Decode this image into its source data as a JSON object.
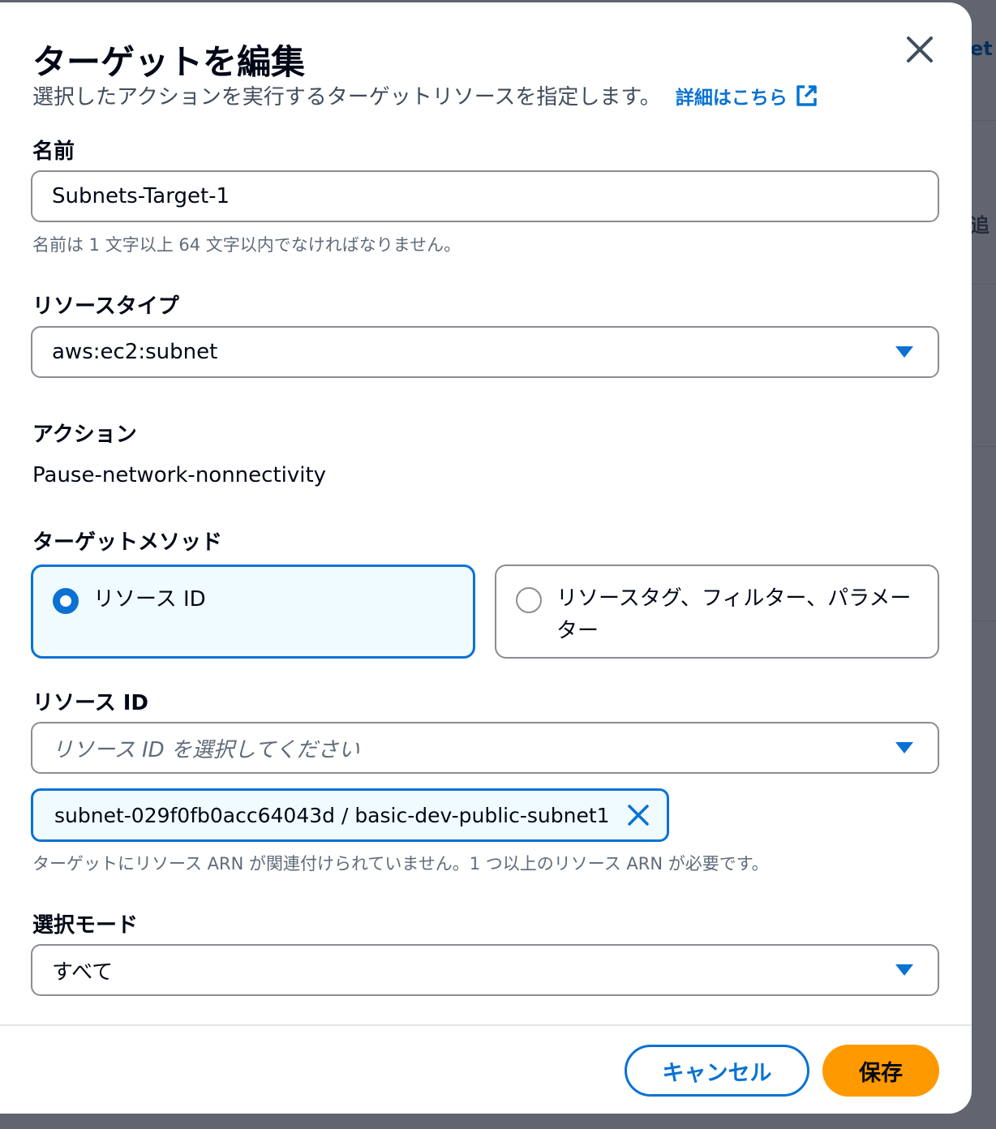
{
  "background": {
    "fragments": [
      "et",
      "追"
    ]
  },
  "modal": {
    "title": "ターゲットを編集",
    "description": "選択したアクションを実行するターゲットリソースを指定します。",
    "learn_more": "詳細はこちら",
    "name": {
      "label": "名前",
      "value": "Subnets-Target-1",
      "hint": "名前は 1 文字以上 64 文字以内でなければなりません。"
    },
    "resource_type": {
      "label": "リソースタイプ",
      "value": "aws:ec2:subnet"
    },
    "action": {
      "label": "アクション",
      "value": "Pause-network-nonnectivity"
    },
    "target_method": {
      "label": "ターゲットメソッド",
      "options": [
        {
          "label": "リソース ID",
          "selected": true
        },
        {
          "label": "リソースタグ、フィルター、パラメーター",
          "selected": false
        }
      ]
    },
    "resource_id": {
      "label": "リソース ID",
      "placeholder": "リソース ID を選択してください",
      "token": "subnet-029f0fb0acc64043d / basic-dev-public-subnet1",
      "hint": "ターゲットにリソース ARN が関連付けられていません。1 つ以上のリソース ARN が必要です。"
    },
    "selection_mode": {
      "label": "選択モード",
      "value": "すべて"
    },
    "buttons": {
      "cancel": "キャンセル",
      "save": "保存"
    }
  },
  "colors": {
    "accent": "#0972d3",
    "primary_button": "#ff9900",
    "border": "#8c8c94",
    "selected_bg": "#f0fbff"
  }
}
